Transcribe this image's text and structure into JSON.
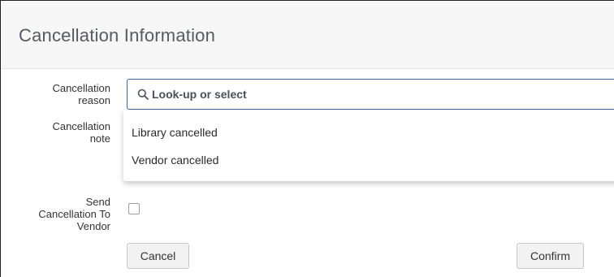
{
  "dialog": {
    "title": "Cancellation Information"
  },
  "form": {
    "reason_label_line1": "Cancellation",
    "reason_label_line2": "reason",
    "note_label_line1": "Cancellation",
    "note_label_line2": "note",
    "send_label_line1": "Send",
    "send_label_line2": "Cancellation To",
    "send_label_line3": "Vendor",
    "search_placeholder": "Look-up or select",
    "send_checked": false
  },
  "dropdown": {
    "options": [
      "Library cancelled",
      "Vendor cancelled"
    ]
  },
  "buttons": {
    "cancel": "Cancel",
    "confirm": "Confirm"
  },
  "colors": {
    "accent": "#2f6fa3",
    "header_bg": "#f7f7f8",
    "title_text": "#555b63"
  }
}
